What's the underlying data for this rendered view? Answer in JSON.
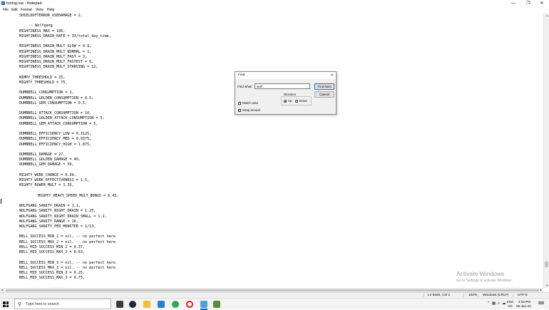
{
  "window": {
    "title": "tuning.lua - Notepad"
  },
  "menu": [
    "File",
    "Edit",
    "Format",
    "View",
    "Help"
  ],
  "editor_lines": [
    {
      "text": "SHIELDOFTERROR_USEDAMAGE = 2,",
      "indent": 0
    },
    {
      "text": "",
      "indent": 0
    },
    {
      "text": "-- Wolfgang",
      "indent": 1
    },
    {
      "text": "MIGHTINESS_MAX = 100,",
      "indent": 0
    },
    {
      "text": "MIGHTINESS_DRAIN_RATE = 33/total_day_time,",
      "indent": 0
    },
    {
      "text": "",
      "indent": 0
    },
    {
      "text": "MIGHTINESS_DRAIN_MULT_SLOW = 0.9,",
      "indent": 0
    },
    {
      "text": "MIGHTINESS_DRAIN_MULT_NORMAL = 1,",
      "indent": 0
    },
    {
      "text": "MIGHTINESS_DRAIN_MULT_FAST = 3,",
      "indent": 0
    },
    {
      "text": "MIGHTINESS_DRAIN_MULT_FASTEST = 6,",
      "indent": 0
    },
    {
      "text": "MIGHTINESS_DRAIN_MULT_STARVING = 12,",
      "indent": 0
    },
    {
      "text": "",
      "indent": 0
    },
    {
      "text": "WIMPY_THRESHOLD = 25,",
      "indent": 0
    },
    {
      "text": "MIGHTY_THRESHOLD = 75,",
      "indent": 0
    },
    {
      "text": "",
      "indent": 0
    },
    {
      "text": "DUMBBELL_CONSUMPTION = 1,",
      "indent": 0
    },
    {
      "text": "DUMBBELL_GOLDEN_CONSUMPTION = 0.5,",
      "indent": 0
    },
    {
      "text": "DUMBBELL_GEM_CONSUMPTION = 0.5,",
      "indent": 0
    },
    {
      "text": "",
      "indent": 0
    },
    {
      "text": "DUMBBELL_ATTACK_CONSUMPTION = 10,",
      "indent": 0
    },
    {
      "text": "DUMBBELL_GOLDEN_ATTACK_CONSUMPTION = 5,",
      "indent": 0
    },
    {
      "text": "DUMBBELL_GEM_ATTACK_CONSUMPTION = 5,",
      "indent": 0
    },
    {
      "text": "",
      "indent": 0
    },
    {
      "text": "DUMBBELL_EFFICIENCY_LOW = 0.3125,",
      "indent": 0
    },
    {
      "text": "DUMBBELL_EFFICIENCY_MED = 0.9375,",
      "indent": 0
    },
    {
      "text": "DUMBBELL_EFFICIENCY_HIGH = 1.875,",
      "indent": 0
    },
    {
      "text": "",
      "indent": 0
    },
    {
      "text": "DUMBBELL_DAMAGE = 27,",
      "indent": 0
    },
    {
      "text": "DUMBBELL_GOLDEN_DAMAGE = 40,",
      "indent": 0
    },
    {
      "text": "DUMBBELL_GEM_DAMAGE = 59,",
      "indent": 0
    },
    {
      "text": "",
      "indent": 0
    },
    {
      "text": "MIGHTY_WORK_CHANCE = 0.99,",
      "indent": 0
    },
    {
      "text": "MIGHTY_WORK_EFFECTIVENESS = 1.5,",
      "indent": 0
    },
    {
      "text": "MIGHTY_ROWER_MULT = 1.33,",
      "indent": 0
    },
    {
      "text": "",
      "indent": 0
    },
    {
      "text": "MIGHTY_HEAVY_SPEED_MULT_BONUS = 0.45,",
      "indent": 2
    },
    {
      "text": "",
      "indent": 0
    },
    {
      "text": "WOLFGANG_SANITY_DRAIN = 1.1,",
      "indent": 0
    },
    {
      "text": "WOLFGANG_SANITY_NIGHT_DRAIN = 1.25,",
      "indent": 0
    },
    {
      "text": "WOLFGANG_SANITY_NIGHT_DRAIN_SMALL = 1.1,",
      "indent": 0
    },
    {
      "text": "WOLFGANG_SANITY_RANGE = 16,",
      "indent": 0
    },
    {
      "text": "WOLFGANG_SANITY_PER_MONSTER = 1/13,",
      "indent": 0
    },
    {
      "text": "",
      "indent": 0
    },
    {
      "text": "BELL_SUCCESS_MIN_2 = nil, -- no perfect here",
      "indent": 0
    },
    {
      "text": "BELL_SUCCESS_MAX_2 = nil, -- no perfect here",
      "indent": 0
    },
    {
      "text": "BELL_MID_SUCCESS_MIN_2 = 0.37,",
      "indent": 0
    },
    {
      "text": "BELL_MID_SUCCESS_MAX_2 = 0.63,",
      "indent": 0
    },
    {
      "text": "",
      "indent": 0
    },
    {
      "text": "BELL_SUCCESS_MIN_3 = nil, -- no perfect here",
      "indent": 0
    },
    {
      "text": "BELL_SUCCESS_MAX_3 = nil, -- no perfect here",
      "indent": 0
    },
    {
      "text": "BELL_MID_SUCCESS_MIN_3 = 0.25,",
      "indent": 0
    },
    {
      "text": "BELL_MID_SUCCESS_MAX_3 = 0.75,",
      "indent": 0
    }
  ],
  "find_dialog": {
    "title": "Find",
    "find_what_label": "Find what:",
    "find_what_value": "wolf",
    "find_next_label": "Find Next",
    "cancel_label": "Cancel",
    "direction_label": "Direction",
    "up_label": "Up",
    "down_label": "Down",
    "direction_selected": "Up",
    "match_case_label": "Match case",
    "match_case_checked": false,
    "wrap_around_label": "Wrap around",
    "wrap_around_checked": false
  },
  "status_bar": {
    "position": "Ln 5626, Col 1",
    "zoom": "100%",
    "line_ending": "Windows (CRLF)",
    "encoding": "UTF-8"
  },
  "watermark": {
    "title": "Activate Windows",
    "subtitle": "Go to Settings to activate Windows."
  },
  "vertical_scroll_position": 0.94,
  "taskbar": {
    "search_placeholder": "Type here to search",
    "language_line1": "ENG",
    "language_line2": "ES",
    "time": "4:02 PM",
    "date": "06-Jan-22",
    "apps": [
      {
        "name": "task-view-icon",
        "color": "#3c3c3c"
      },
      {
        "name": "steam-icon",
        "color": "#1b2838"
      },
      {
        "name": "file-explorer-icon",
        "color": "#f2c12e"
      },
      {
        "name": "mail-icon",
        "color": "#2a7cd6"
      },
      {
        "name": "chrome-icon",
        "color": "#34a853"
      },
      {
        "name": "opera-icon",
        "color": "#e01b24"
      },
      {
        "name": "notepad-icon",
        "color": "#4aa3df"
      },
      {
        "name": "minecraft-icon",
        "color": "#5a8f3a"
      }
    ]
  },
  "colors": {
    "accent": "#0078d7",
    "watermark": "#9a9a9a"
  }
}
